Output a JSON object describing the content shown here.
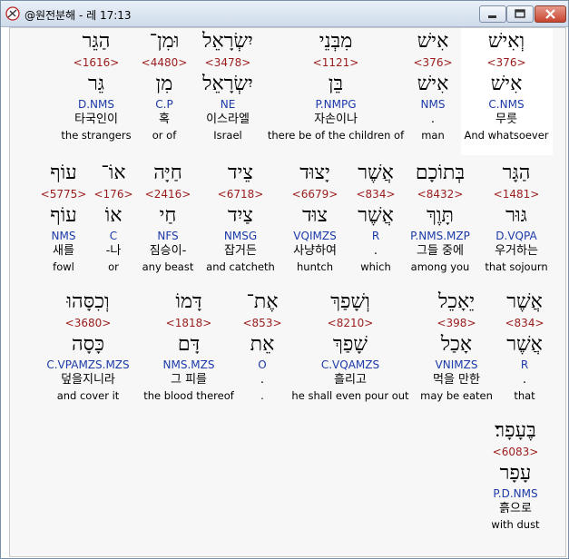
{
  "window": {
    "title": "@원전분해 - 레 17:13",
    "controls": [
      "minimize",
      "maximize",
      "close"
    ]
  },
  "rows": [
    {
      "words": [
        {
          "heb": "וְאִישׁ",
          "strong": "<376>",
          "heb2": "אִישׁ",
          "morph": "C.NMS",
          "kor": "무릇",
          "eng": "And whatsoever",
          "selected": true
        },
        {
          "heb": "אִישׁ",
          "strong": "<376>",
          "heb2": "אִישׁ",
          "morph": "NMS",
          "kor": ".",
          "eng": "man"
        },
        {
          "heb": "מִבְּנֵי",
          "strong": "<1121>",
          "heb2": "בֵּן",
          "morph": "P.NMPG",
          "kor": "자손이나",
          "eng": "there be of the children of"
        },
        {
          "heb": "יִשְׂרָאֵל",
          "strong": "<3478>",
          "heb2": "יִשְׂרָאֵל",
          "morph": "NE",
          "kor": "이스라엘",
          "eng": "Israel"
        },
        {
          "heb": "וּמִן־",
          "strong": "<4480>",
          "heb2": "מִן",
          "morph": "C.P",
          "kor": "혹",
          "eng": "or of"
        },
        {
          "heb": "הַגֵּר",
          "strong": "<1616>",
          "heb2": "גֵּר",
          "morph": "D.NMS",
          "kor": "타국인이",
          "eng": "the strangers"
        }
      ]
    },
    {
      "words": [
        {
          "heb": "הַגָּר",
          "strong": "<1481>",
          "heb2": "גּוּר",
          "morph": "D.VQPA",
          "kor": "우거하는",
          "eng": "that sojourn"
        },
        {
          "heb": "בְּתוֹכָם",
          "strong": "<8432>",
          "heb2": "תָּוֶךְ",
          "morph": "P.NMS.MZP",
          "kor": "그들 중에",
          "eng": "among you"
        },
        {
          "heb": "אֲשֶׁר",
          "strong": "<834>",
          "heb2": "אֲשֶׁר",
          "morph": "R",
          "kor": ".",
          "eng": "which"
        },
        {
          "heb": "יָצוּד",
          "strong": "<6679>",
          "heb2": "צוּד",
          "morph": "VQIMZS",
          "kor": "사냥하여",
          "eng": "huntch"
        },
        {
          "heb": "צֵיד",
          "strong": "<6718>",
          "heb2": "צַיִד",
          "morph": "NMSG",
          "kor": "잡거든",
          "eng": "and catcheth"
        },
        {
          "heb": "חַיָּה",
          "strong": "<2416>",
          "heb2": "חַי",
          "morph": "NFS",
          "kor": "짐승이-",
          "eng": "any beast"
        },
        {
          "heb": "אוֹ־",
          "strong": "<176>",
          "heb2": "אוֹ",
          "morph": "C",
          "kor": "-나",
          "eng": "or"
        },
        {
          "heb": "עוֹף",
          "strong": "<5775>",
          "heb2": "עוֹף",
          "morph": "NMS",
          "kor": "새를",
          "eng": "fowl"
        }
      ]
    },
    {
      "words": [
        {
          "heb": "אֲשֶׁר",
          "strong": "<834>",
          "heb2": "אֲשֶׁר",
          "morph": "R",
          "kor": ".",
          "eng": "that"
        },
        {
          "heb": "יֵאָכֵל",
          "strong": "<398>",
          "heb2": "אָכַל",
          "morph": "VNIMZS",
          "kor": "먹을 만한",
          "eng": "may be eaten"
        },
        {
          "heb": "וְשָׁפַךְ",
          "strong": "<8210>",
          "heb2": "שָׁפַךְ",
          "morph": "C.VQAMZS",
          "kor": "흘리고",
          "eng": "he shall even pour out"
        },
        {
          "heb": "אֶת־",
          "strong": "<853>",
          "heb2": "אֵת",
          "morph": "O",
          "kor": ".",
          "eng": "."
        },
        {
          "heb": "דָּמוֹ",
          "strong": "<1818>",
          "heb2": "דָּם",
          "morph": "NMS.MZS",
          "kor": "그 피를",
          "eng": "the blood thereof"
        },
        {
          "heb": "וְכִסָּהוּ",
          "strong": "<3680>",
          "heb2": "כָּסָה",
          "morph": "C.VPAMZS.MZS",
          "kor": "덮을지니라",
          "eng": "and cover it"
        }
      ]
    },
    {
      "words": [
        {
          "heb": "בֶּעָפָר׃",
          "strong": "<6083>",
          "heb2": "עָפָר",
          "morph": "P.D.NMS",
          "kor": "흙으로",
          "eng": "with dust"
        }
      ]
    }
  ]
}
